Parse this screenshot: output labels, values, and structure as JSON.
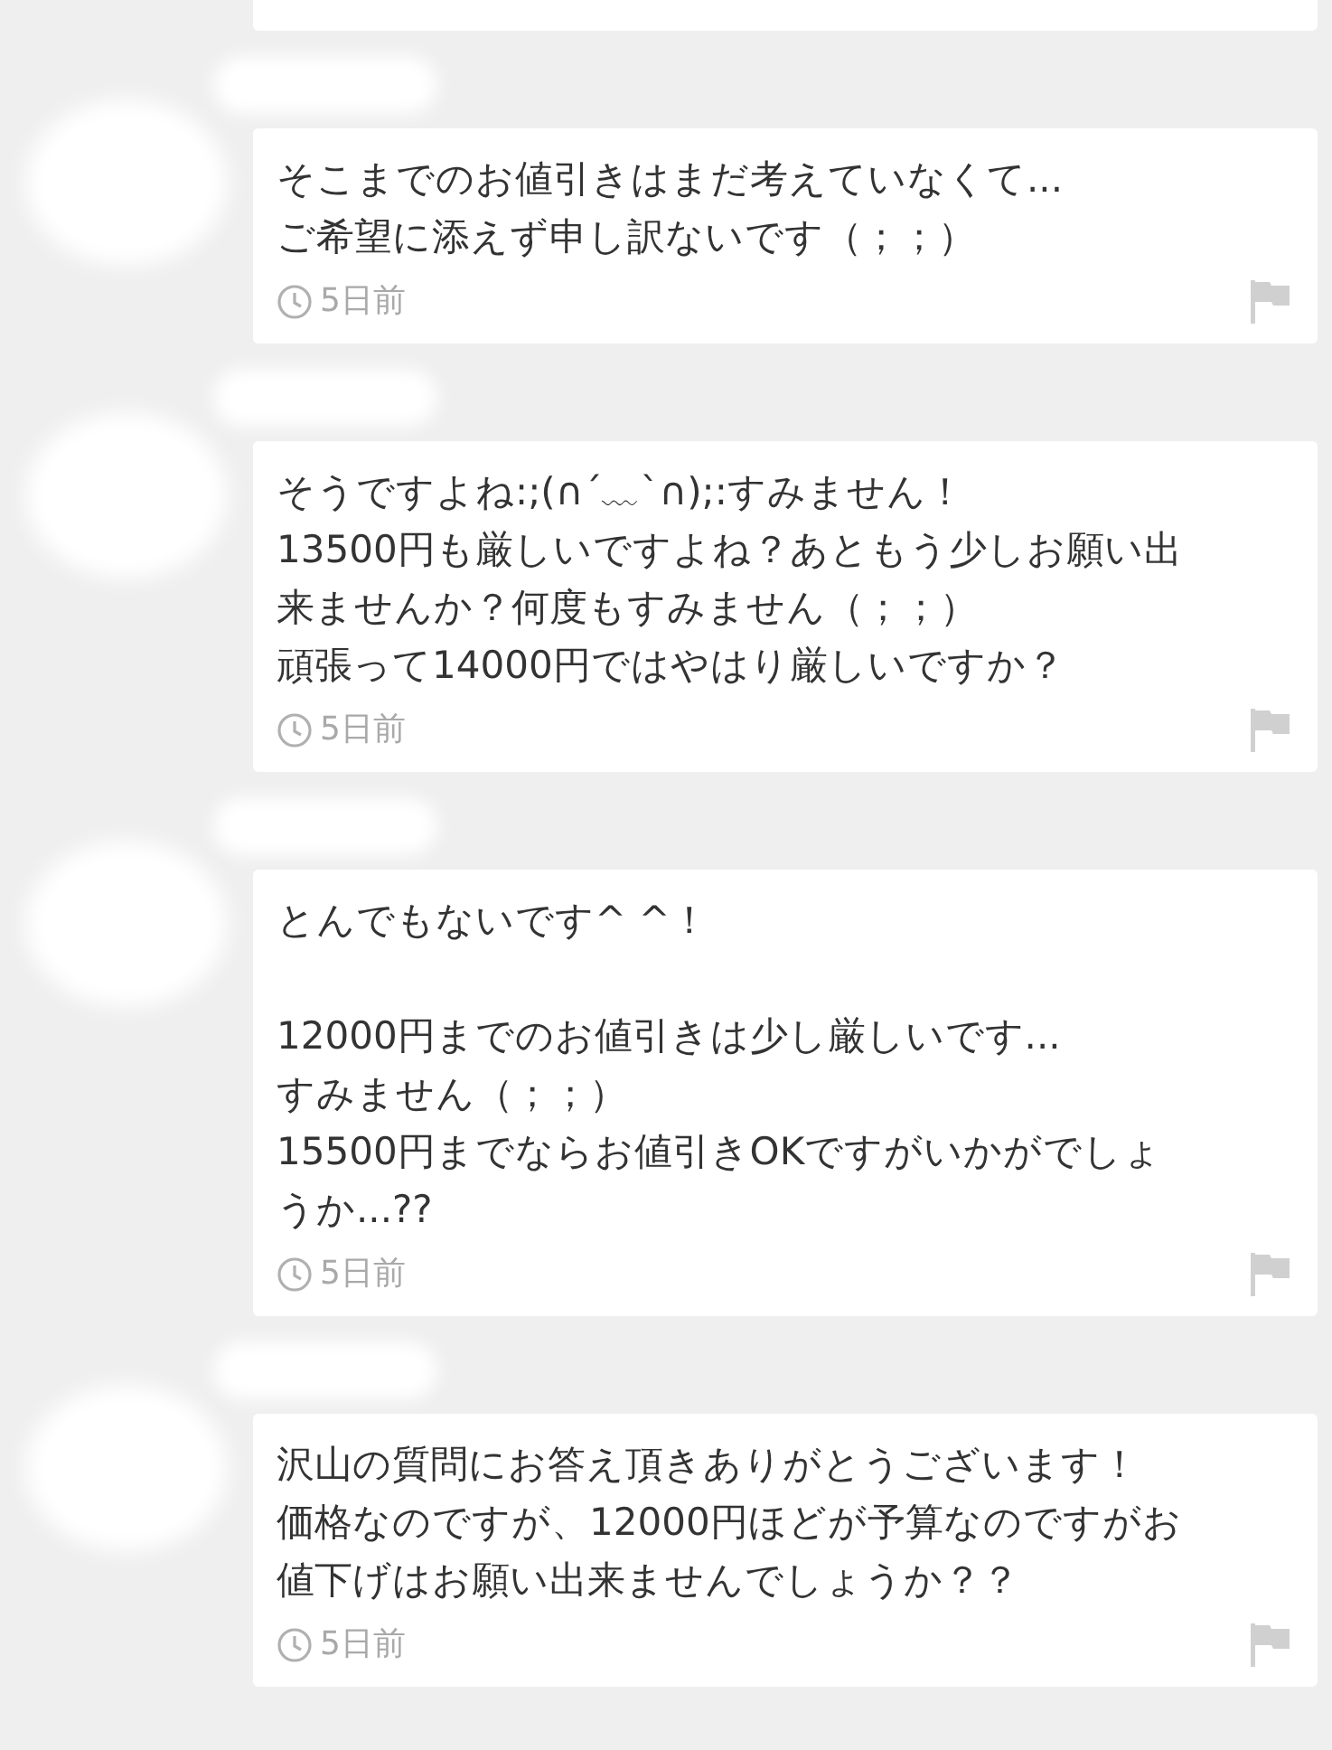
{
  "top_bubble": {
    "partial": true
  },
  "messages": [
    {
      "paragraphs": [
        [
          "そこまでのお値引きはまだ考えていなくて...",
          "ご希望に添えず申し訳ないです（；；）"
        ]
      ],
      "time": "5日前"
    },
    {
      "paragraphs": [
        [
          "そうですよね:;(∩´﹏`∩);:すみません！",
          "13500円も厳しいですよね？あともう少しお願い出",
          "来ませんか？何度もすみません（；；）",
          "頑張って14000円ではやはり厳しいですか？"
        ]
      ],
      "time": "5日前"
    },
    {
      "paragraphs": [
        [
          "とんでもないです^ ^！"
        ],
        [
          "12000円までのお値引きは少し厳しいです...",
          "すみません（；；）",
          "15500円までならお値引きOKですがいかがでしょ",
          "うか...??"
        ]
      ],
      "time": "5日前"
    },
    {
      "paragraphs": [
        [
          "沢山の質問にお答え頂きありがとうございます！",
          "価格なのですが、12000円ほどが予算なのですがお",
          "値下げはお願い出来ませんでしょうか？？"
        ]
      ],
      "time": "5日前"
    }
  ]
}
